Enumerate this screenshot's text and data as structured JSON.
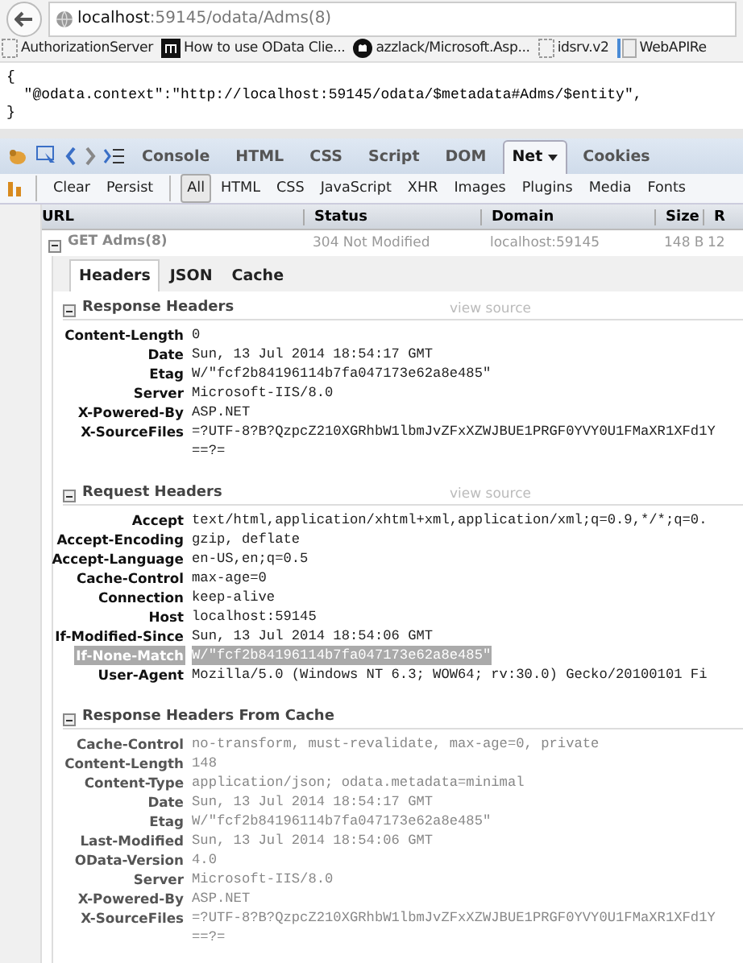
{
  "address_bar": {
    "host": "localhost",
    "path": ":59145/odata/Adms(8)"
  },
  "bookmarks": [
    {
      "label": "AuthorizationServer",
      "kind": "blank"
    },
    {
      "label": "How to use OData Clie...",
      "kind": "square"
    },
    {
      "label": "azzlack/Microsoft.Asp...",
      "kind": "octocat"
    },
    {
      "label": "idsrv.v2",
      "kind": "blank"
    },
    {
      "label": "WebAPIRe",
      "kind": "page"
    }
  ],
  "document": {
    "lines": [
      "{",
      "  \"@odata.context\":\"http://localhost:59145/odata/$metadata#Adms/$entity\",",
      "}"
    ]
  },
  "firebug_tabs": [
    {
      "label": "Console",
      "selected": false
    },
    {
      "label": "HTML",
      "selected": false
    },
    {
      "label": "CSS",
      "selected": false
    },
    {
      "label": "Script",
      "selected": false
    },
    {
      "label": "DOM",
      "selected": false
    },
    {
      "label": "Net",
      "selected": true,
      "menu": true
    },
    {
      "label": "Cookies",
      "selected": false
    }
  ],
  "net_toolbar": {
    "actions": [
      "Clear",
      "Persist"
    ],
    "filters": [
      {
        "label": "All",
        "selected": true
      },
      {
        "label": "HTML",
        "selected": false
      },
      {
        "label": "CSS",
        "selected": false
      },
      {
        "label": "JavaScript",
        "selected": false
      },
      {
        "label": "XHR",
        "selected": false
      },
      {
        "label": "Images",
        "selected": false
      },
      {
        "label": "Plugins",
        "selected": false
      },
      {
        "label": "Media",
        "selected": false
      },
      {
        "label": "Fonts",
        "selected": false
      }
    ]
  },
  "table": {
    "columns": [
      "URL",
      "Status",
      "Domain",
      "Size",
      "R"
    ],
    "rows": [
      {
        "url": "GET Adms(8)",
        "status": "304 Not Modified",
        "domain": "localhost:59145",
        "size": "148 B",
        "column_5": "12",
        "expanded": true
      }
    ]
  },
  "detail_tabs": [
    {
      "label": "Headers",
      "selected": true
    },
    {
      "label": "JSON",
      "selected": false
    },
    {
      "label": "Cache",
      "selected": false
    }
  ],
  "sections": [
    {
      "title": "Response Headers",
      "link": "view source",
      "cached": false,
      "headers": [
        {
          "name": "Content-Length",
          "value": [
            "0"
          ],
          "selected": false
        },
        {
          "name": "Date",
          "value": [
            "Sun, 13 Jul 2014 18:54:17 GMT"
          ],
          "selected": false
        },
        {
          "name": "Etag",
          "value": [
            "W/\"fcf2b84196114b7fa047173e62a8e485\""
          ],
          "selected": false
        },
        {
          "name": "Server",
          "value": [
            "Microsoft-IIS/8.0"
          ],
          "selected": false
        },
        {
          "name": "X-Powered-By",
          "value": [
            "ASP.NET"
          ],
          "selected": false
        },
        {
          "name": "X-SourceFiles",
          "value": [
            "=?UTF-8?B?QzpcZ210XGRhbW1lbmJvZFxXZWJBUE1PRGF0YVY0U1FMaXR1XFd1Y",
            "==?="
          ],
          "selected": false
        }
      ]
    },
    {
      "title": "Request Headers",
      "link": "view source",
      "cached": false,
      "headers": [
        {
          "name": "Accept",
          "value": [
            "text/html,application/xhtml+xml,application/xml;q=0.9,*/*;q=0."
          ],
          "selected": false
        },
        {
          "name": "Accept-Encoding",
          "value": [
            "gzip, deflate"
          ],
          "selected": false
        },
        {
          "name": "Accept-Language",
          "value": [
            "en-US,en;q=0.5"
          ],
          "selected": false
        },
        {
          "name": "Cache-Control",
          "value": [
            "max-age=0"
          ],
          "selected": false
        },
        {
          "name": "Connection",
          "value": [
            "keep-alive"
          ],
          "selected": false
        },
        {
          "name": "Host",
          "value": [
            "localhost:59145"
          ],
          "selected": false
        },
        {
          "name": "If-Modified-Since",
          "value": [
            "Sun, 13 Jul 2014 18:54:06 GMT"
          ],
          "selected": false
        },
        {
          "name": "If-None-Match",
          "value": [
            "W/\"fcf2b84196114b7fa047173e62a8e485\""
          ],
          "selected": true
        },
        {
          "name": "User-Agent",
          "value": [
            "Mozilla/5.0 (Windows NT 6.3; WOW64; rv:30.0) Gecko/20100101 Fi"
          ],
          "selected": false
        }
      ]
    },
    {
      "title": "Response Headers From Cache",
      "cached": true,
      "headers": [
        {
          "name": "Cache-Control",
          "value": [
            "no-transform, must-revalidate, max-age=0, private"
          ],
          "selected": false
        },
        {
          "name": "Content-Length",
          "value": [
            "148"
          ],
          "selected": false
        },
        {
          "name": "Content-Type",
          "value": [
            "application/json; odata.metadata=minimal"
          ],
          "selected": false
        },
        {
          "name": "Date",
          "value": [
            "Sun, 13 Jul 2014 18:54:17 GMT"
          ],
          "selected": false
        },
        {
          "name": "Etag",
          "value": [
            "W/\"fcf2b84196114b7fa047173e62a8e485\""
          ],
          "selected": false
        },
        {
          "name": "Last-Modified",
          "value": [
            "Sun, 13 Jul 2014 18:54:06 GMT"
          ],
          "selected": false
        },
        {
          "name": "OData-Version",
          "value": [
            "4.0"
          ],
          "selected": false
        },
        {
          "name": "Server",
          "value": [
            "Microsoft-IIS/8.0"
          ],
          "selected": false
        },
        {
          "name": "X-Powered-By",
          "value": [
            "ASP.NET"
          ],
          "selected": false
        },
        {
          "name": "X-SourceFiles",
          "value": [
            "=?UTF-8?B?QzpcZ210XGRhbW1lbmJvZFxXZWJBUE1PRGF0YVY0U1FMaXR1XFd1Y",
            "==?="
          ],
          "selected": false
        }
      ]
    }
  ]
}
